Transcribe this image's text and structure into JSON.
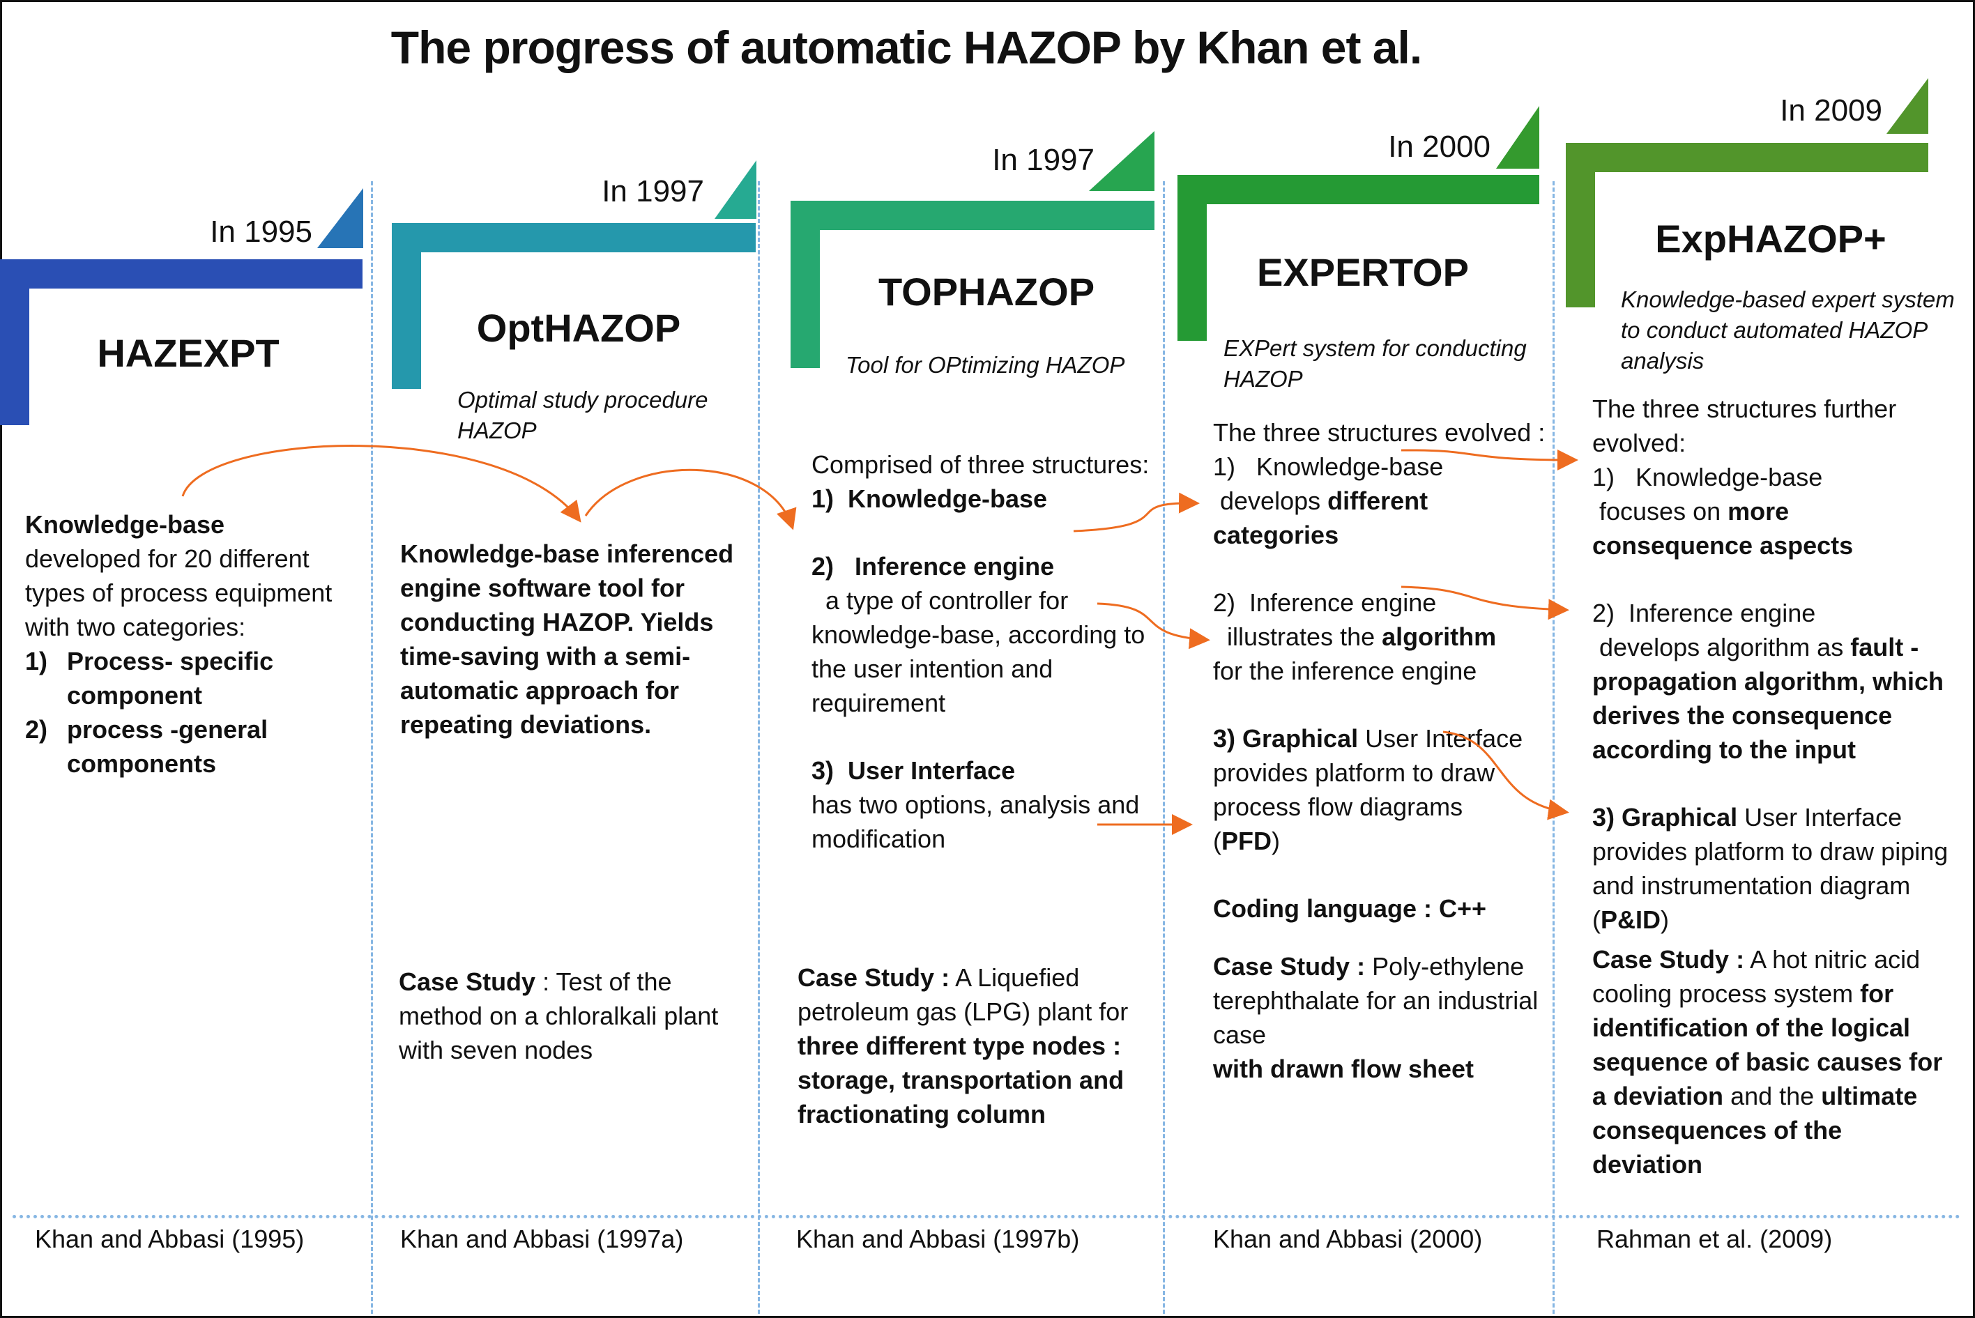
{
  "title": "The progress of automatic HAZOP by Khan et al.",
  "colors": {
    "hazexpt": "#2a4fb4",
    "hazexpt_flag": "#2774b6",
    "opthazop": "#2598ac",
    "opthazop_flag": "#26aa92",
    "tophazop": "#26a870",
    "tophazop_flag": "#27a550",
    "expertop": "#259a34",
    "expertop_flag": "#349a2e",
    "exphazop": "#52952b",
    "exphazop_flag": "#52952b",
    "arrow": "#ee6c20",
    "divider": "#86b6e3"
  },
  "columns": [
    {
      "year": "In 1995",
      "name": "HAZEXPT",
      "subtitle": "",
      "reference": "Khan and Abbasi (1995)",
      "content": {
        "lead_bold": "Knowledge-base",
        "lead_text": "developed for 20 different types of process equipment with two categories:",
        "items": [
          {
            "num": "1)",
            "text": "Process- specific component"
          },
          {
            "num": "2)",
            "text": "process -general components"
          }
        ]
      }
    },
    {
      "year": "In 1997",
      "name": "OptHAZOP",
      "subtitle": "Optimal study procedure HAZOP",
      "reference": "Khan and Abbasi (1997a)",
      "content": {
        "summary_bold": "Knowledge-base inferenced engine software tool for conducting HAZOP. Yields time-saving with a semi-automatic approach for repeating deviations.",
        "case_label": "Case Study",
        "case_sep": " : ",
        "case_text": "Test of the method on a chloralkali plant with seven nodes"
      }
    },
    {
      "year": "In 1997",
      "name": "TOPHAZOP",
      "subtitle": "Tool for OPtimizing HAZOP",
      "reference": "Khan and Abbasi (1997b)",
      "content": {
        "intro": "Comprised of  three structures:",
        "items": [
          {
            "num": "1)",
            "title": "Knowledge-base",
            "text": ""
          },
          {
            "num": "2)",
            "title": "Inference engine",
            "text": "a type of controller for knowledge-base, according to the user intention and requirement"
          },
          {
            "num": "3)",
            "title": "User Interface",
            "text": "has two options, analysis and modification"
          }
        ],
        "case_label": "Case Study :",
        "case_text_1": " A Liquefied petroleum gas (LPG) plant for ",
        "case_bold": "three different type nodes : storage, transportation and fractionating column"
      }
    },
    {
      "year": "In 2000",
      "name": "EXPERTOP",
      "subtitle": "EXPert system for conducting HAZOP",
      "reference": "Khan and Abbasi (2000)",
      "content": {
        "intro": "The three structures evolved :",
        "item1_num": "1)",
        "item1_title": "Knowledge-base",
        "item1_text": "develops ",
        "item1_bold": "different categories",
        "item2_num": "2)",
        "item2_title": "Inference engine",
        "item2_text": "illustrates the ",
        "item2_bold": "algorithm",
        "item2_tail": "for the inference engine",
        "item3_num": "3)",
        "item3_bold": "Graphical",
        "item3_title": " User Interface",
        "item3_text": "provides platform to draw process flow diagrams",
        "item3_abbr": "PFD",
        "coding_label": "Coding language : C++",
        "case_label": "Case Study :",
        "case_text": " Poly-ethylene terephthalate for an industrial case",
        "case_bold": "with drawn flow sheet"
      }
    },
    {
      "year": "In 2009",
      "name": "ExpHAZOP+",
      "subtitle": "Knowledge-based expert system to conduct automated HAZOP analysis",
      "reference": "Rahman et al. (2009)",
      "content": {
        "intro": "The three structures further evolved:",
        "item1_num": "1)",
        "item1_title": "Knowledge-base",
        "item1_text": "focuses on ",
        "item1_bold": "more consequence aspects",
        "item2_num": "2)",
        "item2_title": "Inference engine",
        "item2_text": "develops algorithm as ",
        "item2_bold": "fault - propagation algorithm, which derives the consequence according to the input",
        "item3_num": "3)",
        "item3_bold": "Graphical",
        "item3_title": " User Interface",
        "item3_text": "provides platform to draw piping and instrumentation diagram",
        "item3_abbr": "P&ID",
        "case_label": "Case Study :",
        "case_text_1": " A hot nitric acid cooling process system ",
        "case_bold_1": "for identification of the logical sequence of basic causes for a deviation",
        "case_text_2": " and the ",
        "case_bold_2": "ultimate consequences of the deviation"
      }
    }
  ]
}
